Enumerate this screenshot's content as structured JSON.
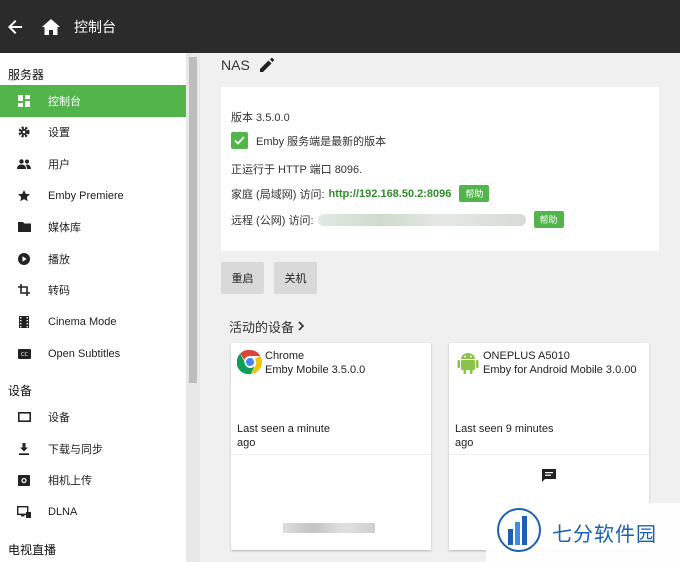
{
  "header": {
    "title": "控制台"
  },
  "sidebar": {
    "sections": [
      {
        "title": "服务器",
        "items": [
          {
            "label": "控制台",
            "icon": "dashboard-icon",
            "active": true
          },
          {
            "label": "设置",
            "icon": "gear-icon"
          },
          {
            "label": "用户",
            "icon": "people-icon"
          },
          {
            "label": "Emby Premiere",
            "icon": "star-icon"
          },
          {
            "label": "媒体库",
            "icon": "folder-icon"
          },
          {
            "label": "播放",
            "icon": "play-icon"
          },
          {
            "label": "转码",
            "icon": "crop-icon"
          },
          {
            "label": "Cinema Mode",
            "icon": "film-icon"
          },
          {
            "label": "Open Subtitles",
            "icon": "cc-icon"
          }
        ]
      },
      {
        "title": "设备",
        "items": [
          {
            "label": "设备",
            "icon": "tablet-icon"
          },
          {
            "label": "下载与同步",
            "icon": "download-icon"
          },
          {
            "label": "相机上传",
            "icon": "camera-icon"
          },
          {
            "label": "DLNA",
            "icon": "dlna-icon"
          }
        ]
      },
      {
        "title": "电视直播",
        "items": []
      }
    ]
  },
  "server": {
    "name": "NAS",
    "version": "版本 3.5.0.0",
    "up_to_date": "Emby 服务端是最新的版本",
    "running": "正运行于 HTTP 端口 8096.",
    "lan_label": "家庭 (局域网) 访问:",
    "lan_url": "http://192.168.50.2:8096",
    "wan_label": "远程 (公网) 访问:",
    "help": "帮助"
  },
  "actions": {
    "restart": "重启",
    "shutdown": "关机"
  },
  "devices": {
    "title": "活动的设备",
    "items": [
      {
        "name": "Chrome",
        "app": "Emby Mobile 3.5.0.0",
        "seen_line1": "Last seen a minute",
        "seen_line2": "ago",
        "icon": "chrome-icon"
      },
      {
        "name": "ONEPLUS A5010",
        "app": "Emby for Android Mobile 3.0.00",
        "seen_line1": "Last seen 9 minutes",
        "seen_line2": "ago",
        "icon": "android-icon"
      }
    ]
  },
  "watermark": {
    "text": "七分软件园"
  },
  "colors": {
    "accent": "#52b54b",
    "topbar": "#2b2b2b"
  }
}
